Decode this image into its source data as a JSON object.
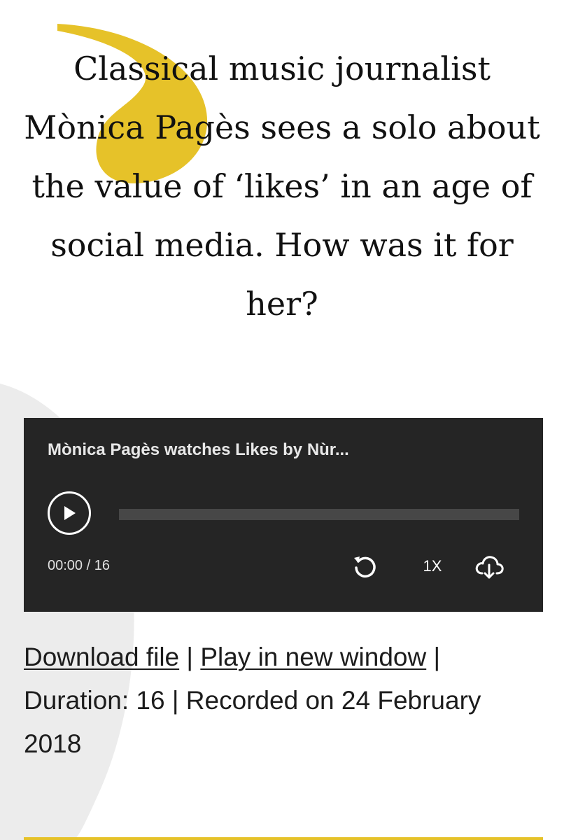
{
  "headline": "Classical music journalist Mònica Pagès sees a solo about the value of ‘likes’ in an age of social media. How was it for her?",
  "player": {
    "title": "Mònica Pagès watches Likes by Nùr...",
    "time_display": "00:00 / 16",
    "progress": 0,
    "speed_label": "1X",
    "play_icon": "play-icon",
    "replay_icon": "replay-icon",
    "download_icon": "cloud-download-icon"
  },
  "links": {
    "download": "Download file",
    "separator": "|",
    "new_window": "Play in new window"
  },
  "meta": {
    "duration_text": "Duration: 16",
    "recorded_text": "Recorded on 24 February 2018"
  },
  "colors": {
    "accent_yellow": "#e6c229",
    "player_bg": "#252525",
    "deco_gray": "#ececec"
  }
}
